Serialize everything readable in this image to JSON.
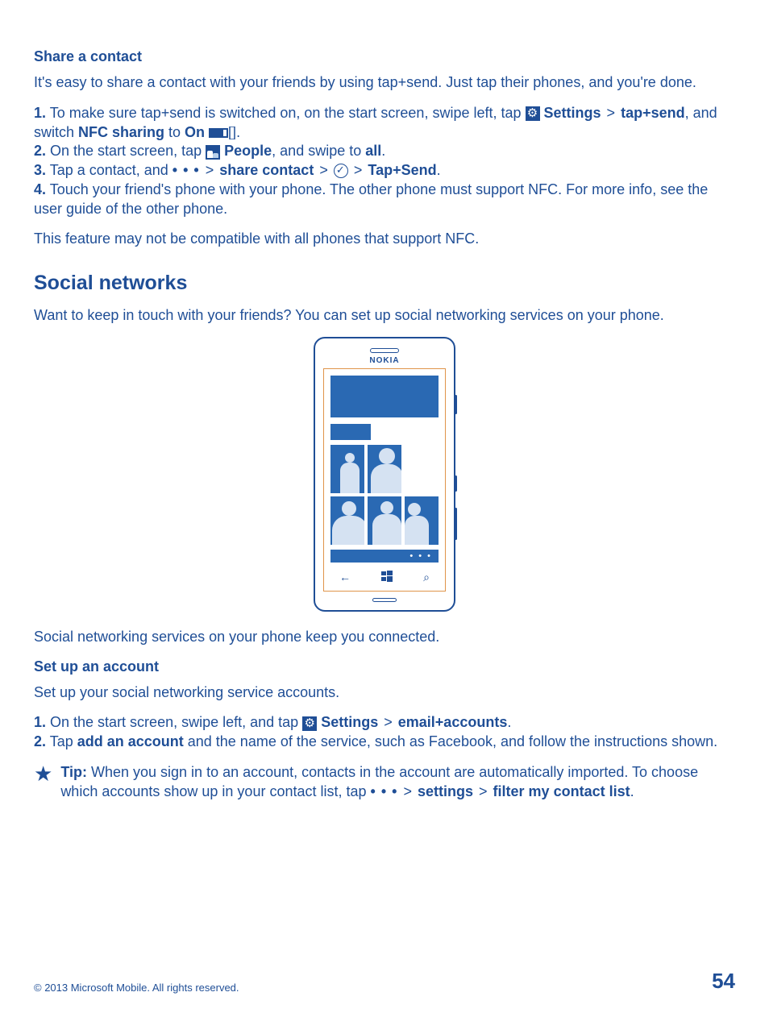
{
  "section1": {
    "heading": "Share a contact",
    "intro": "It's easy to share a contact with your friends by using tap+send. Just tap their phones, and you're done.",
    "step1_a": "1.",
    "step1_b": " To make sure tap+send is switched on, on the start screen, swipe left, tap ",
    "step1_settings": "Settings",
    "step1_c": "tap+send",
    "step1_d": ", and switch ",
    "step1_nfc": "NFC sharing",
    "step1_to": " to ",
    "step1_on": "On",
    "step1_end": ".",
    "step2_a": "2.",
    "step2_b": " On the start screen, tap ",
    "step2_people": "People",
    "step2_c": ", and swipe to ",
    "step2_all": "all",
    "step2_end": ".",
    "step3_a": "3.",
    "step3_b": " Tap a contact, and  ",
    "step3_dots": "• • •",
    "step3_share": "share contact",
    "step3_tapsend": "Tap+Send",
    "step3_end": ".",
    "step4_a": "4.",
    "step4_b": " Touch your friend's phone with your phone. The other phone must support NFC. For more info, see the user guide of the other phone.",
    "note": "This feature may not be compatible with all phones that support NFC."
  },
  "section2": {
    "heading": "Social networks",
    "intro": "Want to keep in touch with your friends? You can set up social networking services on your phone.",
    "after_image": "Social networking services on your phone keep you connected."
  },
  "phone": {
    "brand": "NOKIA",
    "nav_back": "←",
    "nav_search": "⌕",
    "dots": "• • •"
  },
  "section3": {
    "heading": "Set up an account",
    "intro": "Set up your social networking service accounts.",
    "step1_a": "1.",
    "step1_b": " On the start screen, swipe left, and tap ",
    "step1_settings": "Settings",
    "step1_email": "email+accounts",
    "step1_end": ".",
    "step2_a": "2.",
    "step2_b": " Tap ",
    "step2_add": "add an account",
    "step2_c": " and the name of the service, such as Facebook, and follow the instructions shown."
  },
  "tip": {
    "label": "Tip:",
    "text_a": " When you sign in to an account, contacts in the account are automatically imported. To choose which accounts show up in your contact list, tap  ",
    "dots": "• • •",
    "settings": "settings",
    "filter": "filter my contact list",
    "end": "."
  },
  "footer": {
    "copyright": "© 2013 Microsoft Mobile. All rights reserved.",
    "page": "54"
  },
  "gt": ">"
}
